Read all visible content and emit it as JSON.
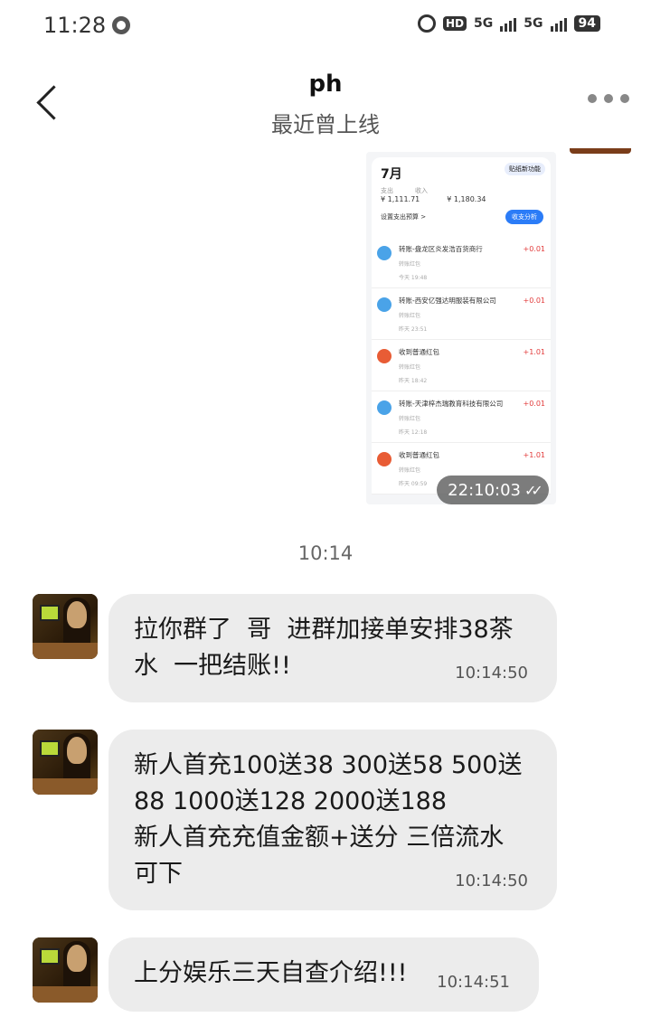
{
  "status_bar": {
    "time": "11:28",
    "hd": "HD",
    "sim1": "5G",
    "sim2": "5G",
    "battery": "94"
  },
  "header": {
    "title": "ph",
    "subtitle": "最近曾上线"
  },
  "screenshot_message": {
    "month": "7月",
    "new_feature": "贴纸新功能",
    "expense_label": "支出",
    "income_label": "收入",
    "expense": "¥ 1,111.71",
    "income": "¥ 1,180.34",
    "budget": "设置支出预算 >",
    "analysis_button": "收支分析",
    "transactions": [
      {
        "name": "转账-盘龙区炎发浩百货商行",
        "sub": "转账红包",
        "time": "今天 19:48",
        "amount": "+0.01",
        "icon": "user-icon"
      },
      {
        "name": "转账-西安亿强达明服装有限公司",
        "sub": "转账红包",
        "time": "昨天 23:51",
        "amount": "+0.01",
        "icon": "user-icon"
      },
      {
        "name": "收到普通红包",
        "sub": "转账红包",
        "time": "昨天 18:42",
        "amount": "+1.01",
        "icon": "red-packet-icon"
      },
      {
        "name": "转账-天津梓杰瑞教育科技有限公司",
        "sub": "转账红包",
        "time": "昨天 12:18",
        "amount": "+0.01",
        "icon": "user-icon"
      },
      {
        "name": "收到普通红包",
        "sub": "转账红包",
        "time": "昨天 09:59",
        "amount": "+1.01",
        "icon": "red-packet-icon"
      }
    ],
    "timestamp": "22:10:03"
  },
  "day_separator": "10:14",
  "messages": [
    {
      "text": "拉你群了  哥  进群加接单安排38茶\n水  一把结账!!",
      "time": "10:14:50"
    },
    {
      "text": "新人首充100送38 300送58 500送\n88 1000送128 2000送188\n新人首充充值金额+送分 三倍流水\n可下",
      "time": "10:14:50"
    },
    {
      "text": "上分娱乐三天自查介绍!!!",
      "time": "10:14:51"
    }
  ]
}
